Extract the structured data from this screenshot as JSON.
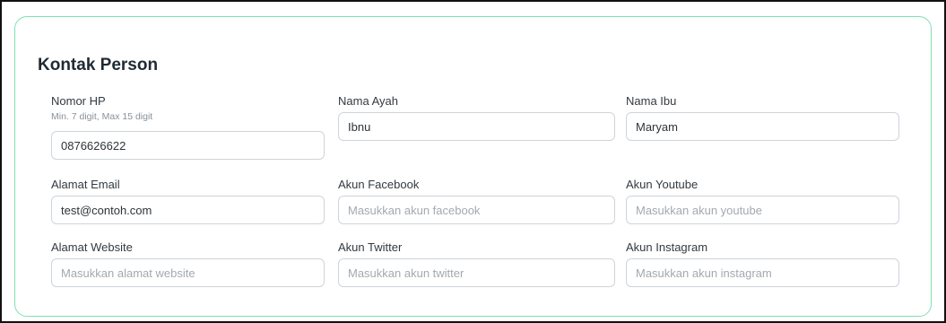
{
  "section": {
    "title": "Kontak Person"
  },
  "fields": {
    "nomor_hp": {
      "label": "Nomor HP",
      "hint": "Min. 7 digit, Max 15 digit",
      "value": "0876626622",
      "placeholder": ""
    },
    "nama_ayah": {
      "label": "Nama Ayah",
      "value": "Ibnu",
      "placeholder": ""
    },
    "nama_ibu": {
      "label": "Nama Ibu",
      "value": "Maryam",
      "placeholder": ""
    },
    "alamat_email": {
      "label": "Alamat Email",
      "value": "test@contoh.com",
      "placeholder": ""
    },
    "akun_facebook": {
      "label": "Akun Facebook",
      "value": "",
      "placeholder": "Masukkan akun facebook"
    },
    "akun_youtube": {
      "label": "Akun Youtube",
      "value": "",
      "placeholder": "Masukkan akun youtube"
    },
    "alamat_website": {
      "label": "Alamat Website",
      "value": "",
      "placeholder": "Masukkan alamat website"
    },
    "akun_twitter": {
      "label": "Akun Twitter",
      "value": "",
      "placeholder": "Masukkan akun twitter"
    },
    "akun_instagram": {
      "label": "Akun Instagram",
      "value": "",
      "placeholder": "Masukkan akun instagram"
    }
  },
  "colors": {
    "card_border": "#7fe0b2",
    "input_border": "#cfd4da",
    "placeholder": "#a3a9b0"
  }
}
